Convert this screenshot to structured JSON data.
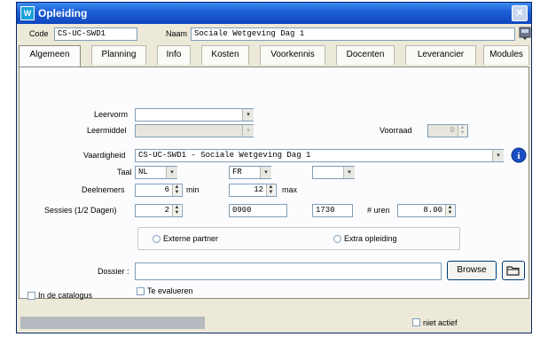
{
  "window": {
    "title": "Opleiding",
    "close_glyph": "✕",
    "icon_text": "W"
  },
  "header": {
    "code_label": "Code",
    "code_value": "CS-UC-SWD1",
    "naam_label": "Naam",
    "naam_value": "Sociale Wetgeving Dag 1"
  },
  "tabs": [
    "Algemeen",
    "Planning",
    "Info",
    "Kosten",
    "Voorkennis",
    "Docenten",
    "Leverancier",
    "Modules"
  ],
  "form": {
    "leervorm_label": "Leervorm",
    "leervorm_value": "",
    "leermiddel_label": "Leermiddel",
    "leermiddel_value": "",
    "voorraad_label": "Voorraad",
    "voorraad_value": "0",
    "vaardigheid_label": "Vaardigheid",
    "vaardigheid_value": "CS-UC-SWD1 - Sociale Wetgeving Dag 1",
    "taal_label": "Taal",
    "taal_1": "NL",
    "taal_2": "FR",
    "taal_3": "",
    "deelnemers_label": "Deelnemers",
    "deelnemers_min": "6",
    "min_label": "min",
    "deelnemers_max": "12",
    "max_label": "max",
    "sessies_label": "Sessies (1/2 Dagen)",
    "sessies_value": "2",
    "start_time": "0900",
    "end_time": "1730",
    "uren_label": "# uren",
    "uren_value": "8.00",
    "externe_partner_label": "Externe partner",
    "extra_opleiding_label": "Extra opleiding",
    "dossier_label": "Dossier :",
    "dossier_value": "",
    "browse_label": "Browse",
    "te_evalueren_label": "Te evalueren",
    "in_catalogus_label": "In de catalogus"
  },
  "status": {
    "niet_actief_label": "niet actief"
  },
  "icons": {
    "info": "info-icon",
    "folder": "folder-icon",
    "lookup": "lookup-icon",
    "dropdown": "▾"
  }
}
